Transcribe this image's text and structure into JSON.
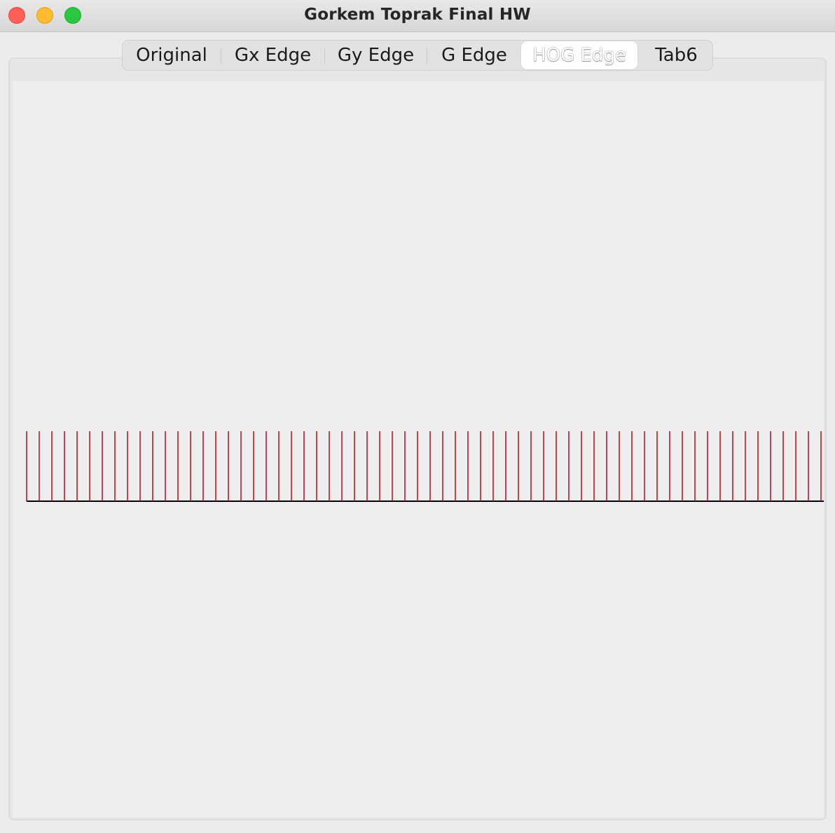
{
  "window": {
    "title": "Gorkem Toprak Final HW",
    "buttons": [
      "close",
      "minimize",
      "zoom"
    ]
  },
  "tabs": [
    {
      "label": "Original",
      "selected": false
    },
    {
      "label": "Gx Edge",
      "selected": false
    },
    {
      "label": "Gy Edge",
      "selected": false
    },
    {
      "label": "G Edge",
      "selected": false
    },
    {
      "label": "HOG Edge",
      "selected": true
    },
    {
      "label": "Tab6",
      "selected": false
    }
  ],
  "hog_plot": {
    "bar_count": 64,
    "bar_values": [
      1,
      1,
      1,
      1,
      1,
      1,
      1,
      1,
      1,
      1,
      1,
      1,
      1,
      1,
      1,
      1,
      1,
      1,
      1,
      1,
      1,
      1,
      1,
      1,
      1,
      1,
      1,
      1,
      1,
      1,
      1,
      1,
      1,
      1,
      1,
      1,
      1,
      1,
      1,
      1,
      1,
      1,
      1,
      1,
      1,
      1,
      1,
      1,
      1,
      1,
      1,
      1,
      1,
      1,
      1,
      1,
      1,
      1,
      1,
      1,
      1,
      1,
      1,
      1
    ],
    "bar_color": "#d0121b",
    "baseline_color": "#000000"
  },
  "colors": {
    "close": "#fe5f57",
    "minimize": "#febc2e",
    "zoom": "#28c840",
    "content_background": "#eeeeee"
  }
}
